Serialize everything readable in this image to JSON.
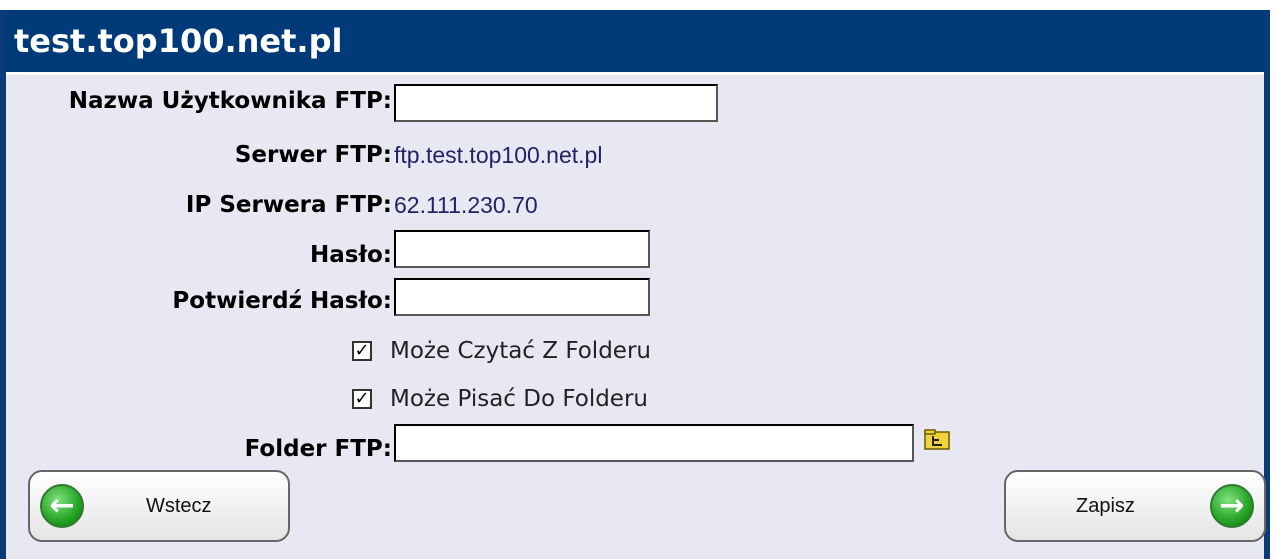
{
  "window": {
    "title": "test.top100.net.pl"
  },
  "form": {
    "username_label": "Nazwa Użytkownika FTP:",
    "username_value": "",
    "server_label": "Serwer FTP:",
    "server_value": "ftp.test.top100.net.pl",
    "ip_label": "IP Serwera FTP:",
    "ip_value": "62.111.230.70",
    "password_label": "Hasło:",
    "password_value": "",
    "confirm_label": "Potwierdź Hasło:",
    "confirm_value": "",
    "read_label": "Może Czytać Z Folderu",
    "read_checked": true,
    "write_label": "Może Pisać Do Folderu",
    "write_checked": true,
    "folder_label": "Folder FTP:",
    "folder_value": ""
  },
  "buttons": {
    "back_label": "Wstecz",
    "save_label": "Zapisz"
  },
  "colors": {
    "titlebar": "#003a78",
    "panel_bg": "#e8e8f2",
    "arrow_green": "#1e9e1e"
  },
  "icons": {
    "back": "arrow-left-icon",
    "save": "arrow-right-icon",
    "folder": "folder-browse-icon"
  }
}
